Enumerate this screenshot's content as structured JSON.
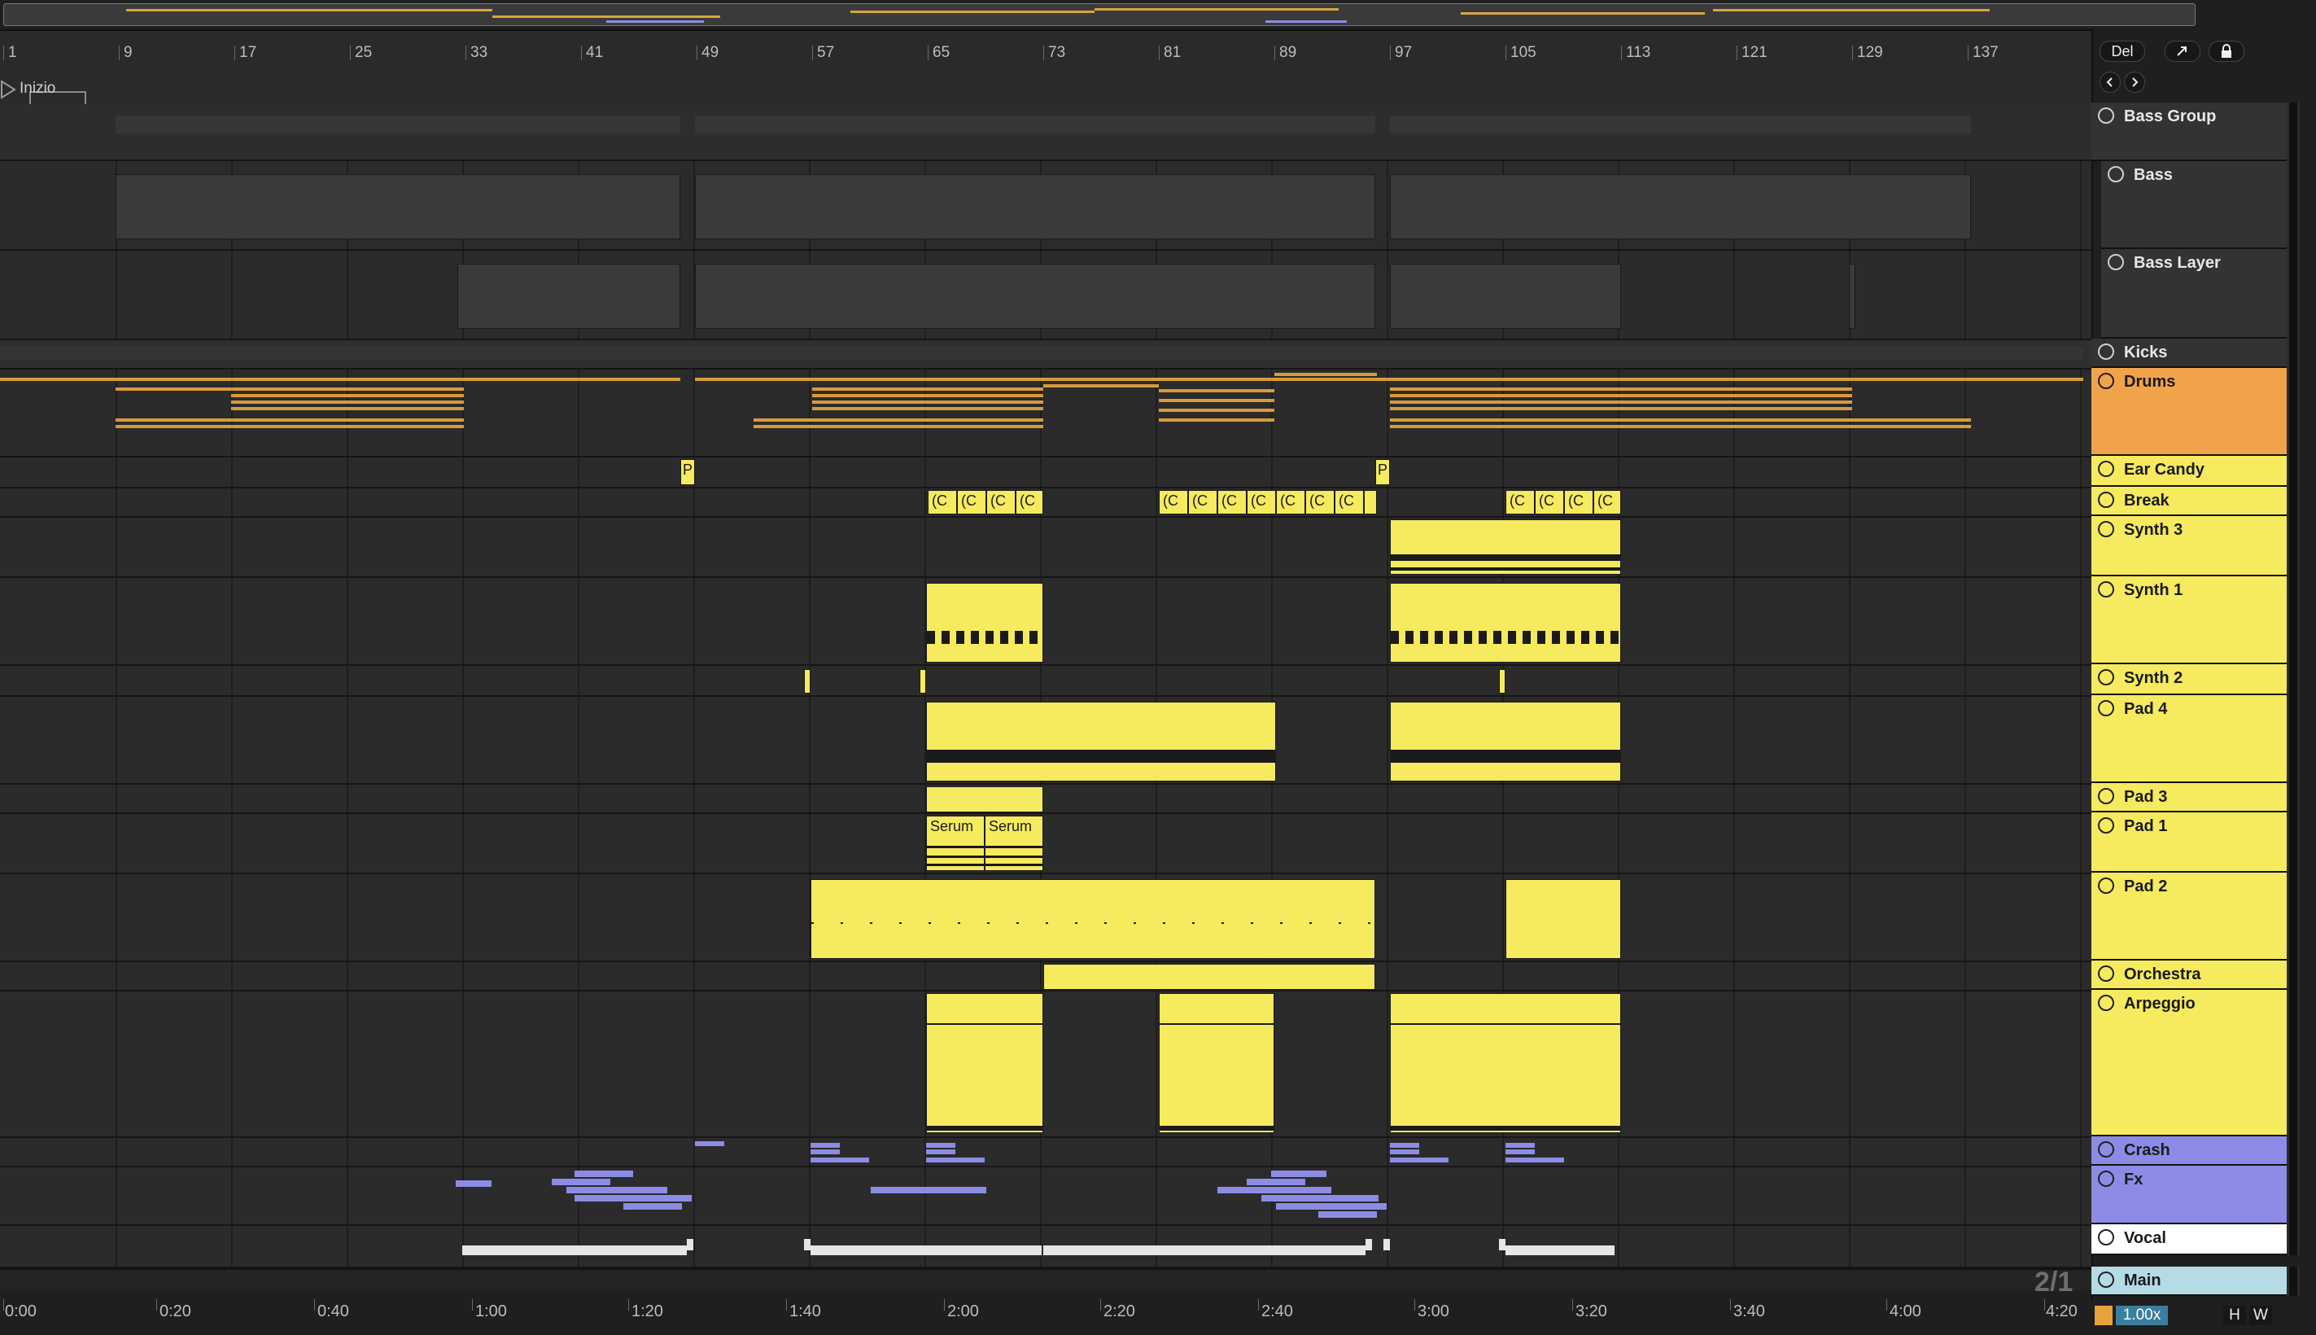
{
  "header": {
    "delete_label": "Del",
    "expand_icon": "expand-icon",
    "lock_icon": "lock-icon",
    "back_icon": "arrow-left-icon",
    "forward_icon": "arrow-right-icon"
  },
  "ruler": {
    "bars": [
      "1",
      "9",
      "17",
      "25",
      "33",
      "41",
      "49",
      "57",
      "65",
      "73",
      "81",
      "89",
      "97",
      "105",
      "113",
      "121",
      "129",
      "137"
    ],
    "start_label": "Inizio"
  },
  "timeline": {
    "times": [
      "0:00",
      "0:20",
      "0:40",
      "1:00",
      "1:20",
      "1:40",
      "2:00",
      "2:20",
      "2:40",
      "3:00",
      "3:20",
      "3:40",
      "4:00",
      "4:20"
    ],
    "time_signature": "2/1"
  },
  "clips": {
    "pitch_1": "P",
    "pitch_2": "P",
    "break_label": "(C",
    "serum_1": "Serum",
    "serum_2": "Serum"
  },
  "tracks": [
    {
      "name": "Bass Group",
      "type": "group",
      "color": "#3b3b3b"
    },
    {
      "name": "Bass",
      "type": "sub",
      "color": "#3b3b3b"
    },
    {
      "name": "Bass Layer",
      "type": "sub",
      "color": "#3b3b3b"
    },
    {
      "name": "Kicks",
      "type": "group",
      "color": "#3b3b3b"
    },
    {
      "name": "Drums",
      "type": "group",
      "color": "#f0a34a"
    },
    {
      "name": "Ear Candy",
      "type": "audio",
      "color": "#f6ea5e"
    },
    {
      "name": "Break",
      "type": "audio",
      "color": "#f6ea5e"
    },
    {
      "name": "Synth 3",
      "type": "midi",
      "color": "#f6ea5e"
    },
    {
      "name": "Synth 1",
      "type": "midi",
      "color": "#f6ea5e"
    },
    {
      "name": "Synth 2",
      "type": "audio",
      "color": "#f6ea5e"
    },
    {
      "name": "Pad 4",
      "type": "midi",
      "color": "#f6ea5e"
    },
    {
      "name": "Pad 3",
      "type": "audio",
      "color": "#f6ea5e"
    },
    {
      "name": "Pad 1",
      "type": "audio",
      "color": "#f6ea5e"
    },
    {
      "name": "Pad 2",
      "type": "midi",
      "color": "#f6ea5e"
    },
    {
      "name": "Orchestra",
      "type": "audio",
      "color": "#f6ea5e"
    },
    {
      "name": "Arpeggio",
      "type": "midi",
      "color": "#f6ea5e"
    },
    {
      "name": "Crash",
      "type": "group",
      "color": "#8c8ce6"
    },
    {
      "name": "Fx",
      "type": "group",
      "color": "#8c8ce6"
    },
    {
      "name": "Vocal",
      "type": "group",
      "color": "#ffffff"
    },
    {
      "name": "Main",
      "type": "main",
      "color": "#b4dbe6"
    }
  ],
  "footer": {
    "tempo_scale": "1.00x",
    "h_label": "H",
    "w_label": "W"
  },
  "colors": {
    "accent_yellow": "#f6ea5e",
    "accent_orange": "#f0a34a",
    "accent_purple": "#8c8ce6",
    "main_blue": "#b4dbe6"
  }
}
